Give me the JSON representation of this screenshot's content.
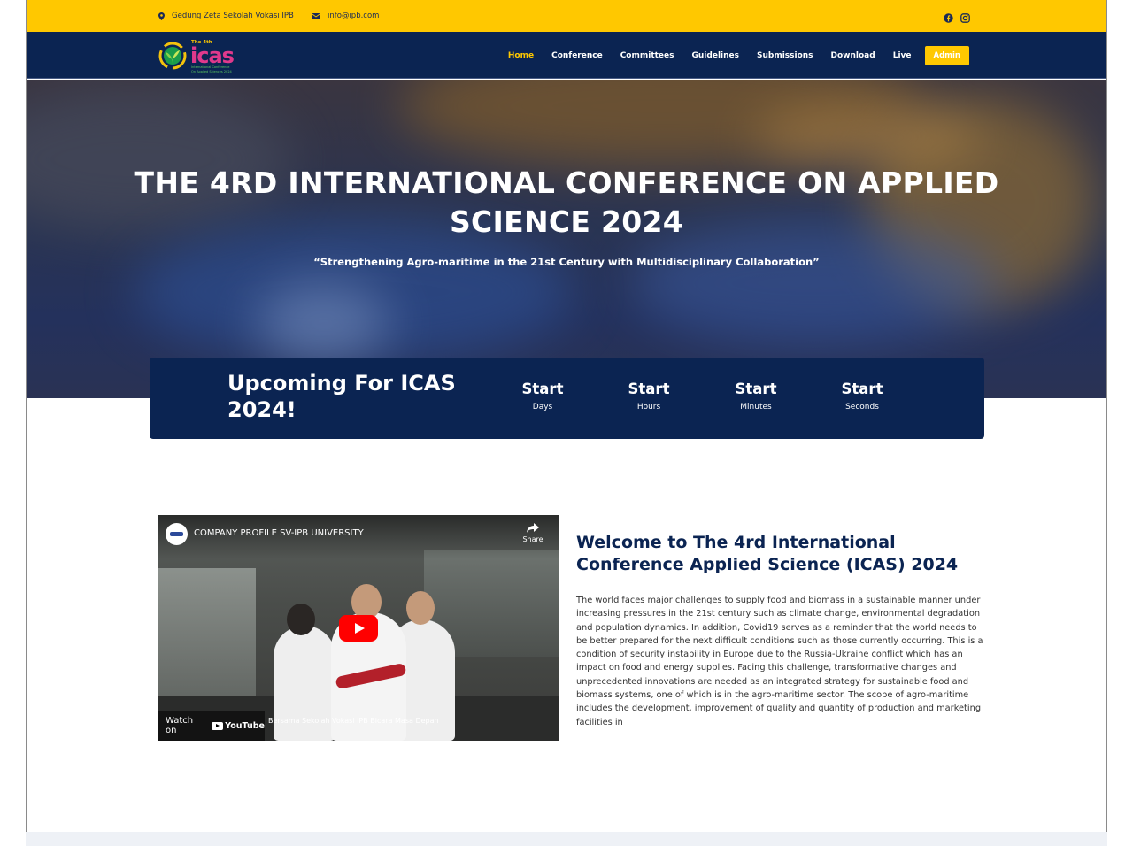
{
  "topbar": {
    "address": "Gedung Zeta Sekolah Vokasi IPB",
    "email": "info@ipb.com",
    "social_icons": [
      "facebook-icon",
      "instagram-icon"
    ]
  },
  "brand": {
    "logo_small": "The 4th",
    "logo_main": "icas",
    "logo_tag1": "International Conference",
    "logo_tag2": "On Applied Sciences 2024"
  },
  "nav": {
    "items": [
      "Home",
      "Conference",
      "Committees",
      "Guidelines",
      "Submissions",
      "Download",
      "Live"
    ],
    "active": "Home",
    "admin_label": "Admin"
  },
  "hero": {
    "title_line1": "THE 4RD INTERNATIONAL CONFERENCE ON APPLIED",
    "title_line2": "SCIENCE 2024",
    "subtitle": "“Strengthening Agro-maritime in the 21st Century with Multidisciplinary Collaboration”"
  },
  "countdown": {
    "heading_line1": "Upcoming For ICAS",
    "heading_line2": "2024!",
    "cells": [
      {
        "value": "Start",
        "label": "Days"
      },
      {
        "value": "Start",
        "label": "Hours"
      },
      {
        "value": "Start",
        "label": "Minutes"
      },
      {
        "value": "Start",
        "label": "Seconds"
      }
    ]
  },
  "video": {
    "title": "COMPANY PROFILE SV-IPB UNIVERSITY",
    "share_label": "Share",
    "watch_on": "Watch on",
    "youtube": "YouTube",
    "caption": "Bersama Sekolah Vokasi IPB Bicara Masa Depan"
  },
  "welcome": {
    "heading": "Welcome to The 4rd International Conference Applied Science (ICAS) 2024",
    "body": "The world faces major challenges to supply food and biomass in a sustainable manner under increasing pressures in the 21st century such as climate change, environmental degradation and population dynamics. In addition, Covid19 serves as a reminder that the world needs to be better prepared for the next difficult conditions such as those currently occurring. This is a condition of security instability in Europe due to the Russia-Ukraine conflict which has an impact on food and energy supplies. Facing this challenge, transformative changes and unprecedented innovations are needed as an integrated strategy for sustainable food and biomass systems, one of which is in the agro-maritime sector. The scope of agro-maritime includes the development, improvement of quality and quantity of production and marketing facilities in"
  },
  "colors": {
    "yellow": "#ffc800",
    "navy": "#0b2452"
  }
}
